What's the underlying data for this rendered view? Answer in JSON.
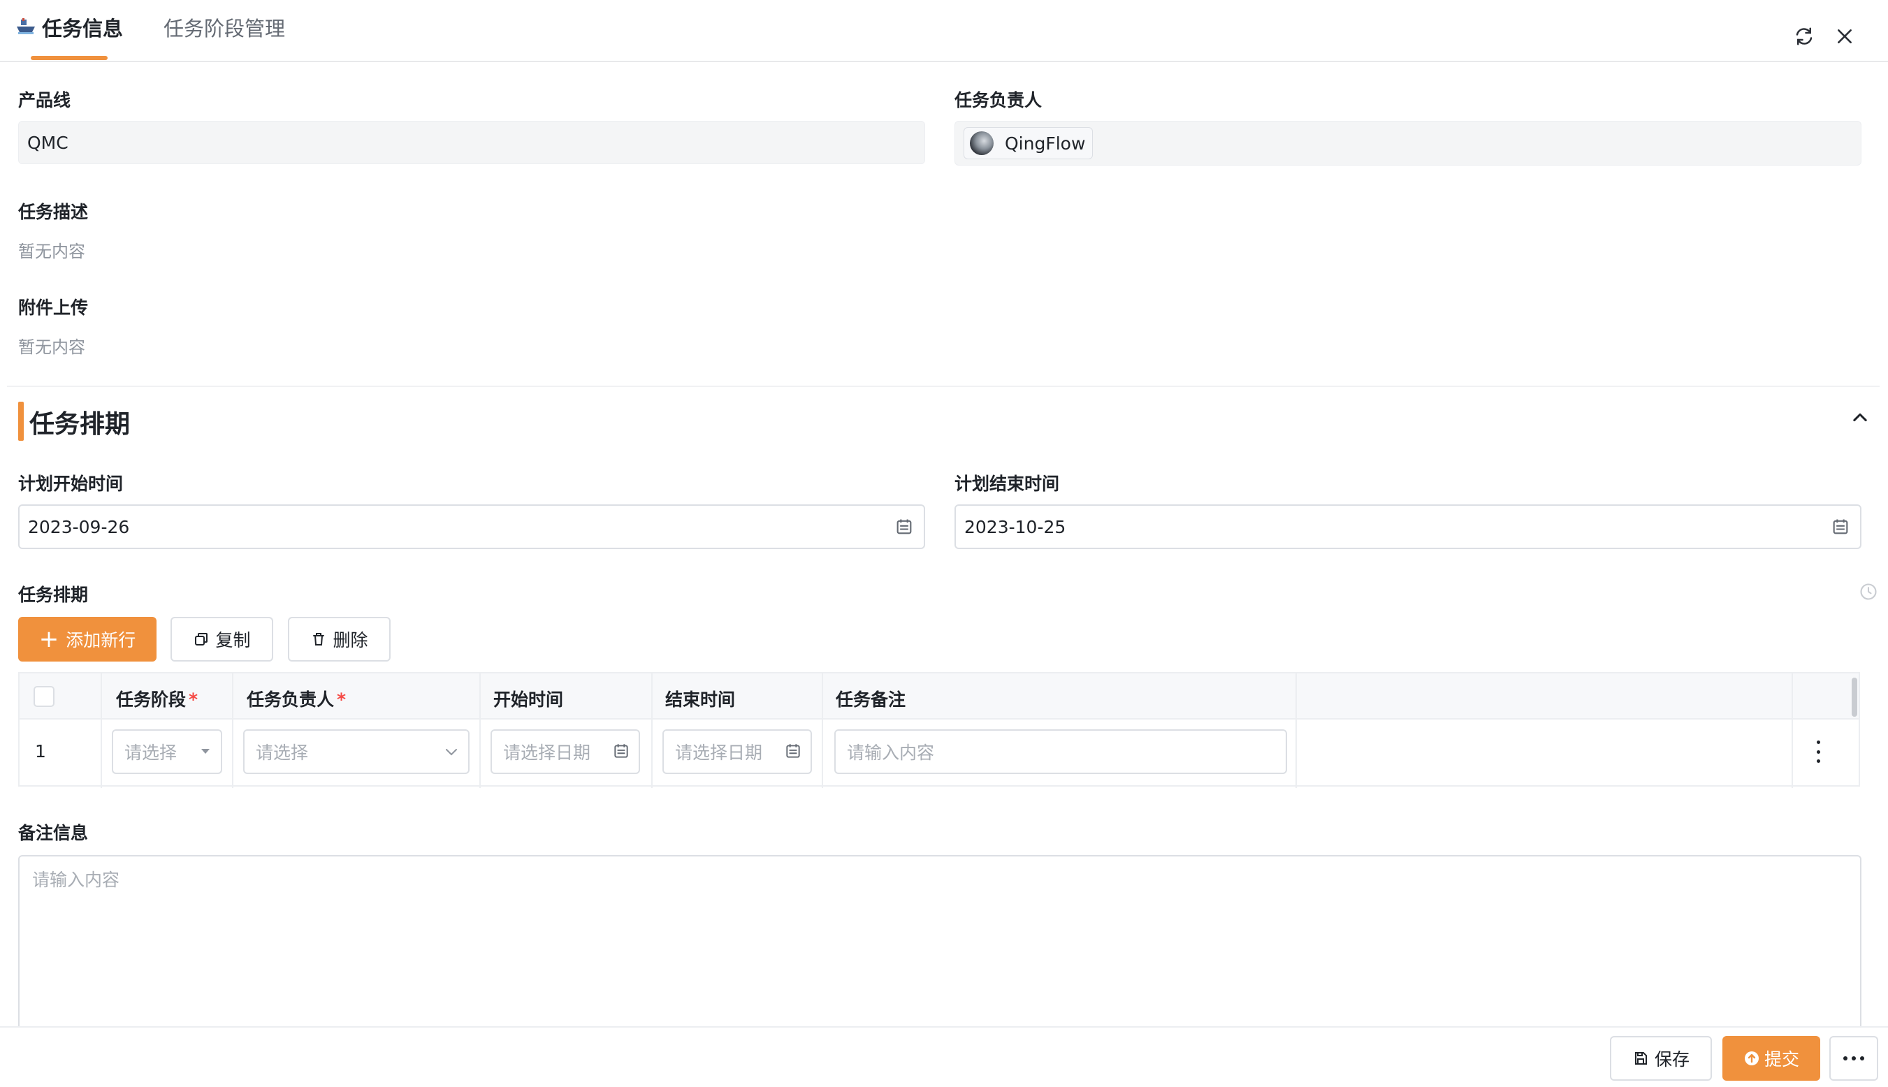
{
  "tabs": [
    {
      "label": "任务信息",
      "active": true,
      "icon": "ship-icon"
    },
    {
      "label": "任务阶段管理",
      "active": false
    }
  ],
  "header_actions": [
    "refresh-icon",
    "close-icon"
  ],
  "fields": {
    "product_line": {
      "label": "产品线",
      "value": "QMC"
    },
    "owner": {
      "label": "任务负责人",
      "value": "QingFlow"
    },
    "description": {
      "label": "任务描述",
      "value": "暂无内容"
    },
    "attachment": {
      "label": "附件上传",
      "value": "暂无内容"
    }
  },
  "section": {
    "title": "任务排期"
  },
  "schedule": {
    "start": {
      "label": "计划开始时间",
      "value": "2023-09-26"
    },
    "end": {
      "label": "计划结束时间",
      "value": "2023-10-25"
    }
  },
  "subtable": {
    "label": "任务排期",
    "buttons": {
      "add": "添加新行",
      "copy": "复制",
      "delete": "删除"
    },
    "columns": [
      "任务阶段",
      "任务负责人",
      "开始时间",
      "结束时间",
      "任务备注"
    ],
    "rows": [
      {
        "index": "1",
        "stage_placeholder": "请选择",
        "owner_placeholder": "请选择",
        "start_placeholder": "请选择日期",
        "end_placeholder": "请选择日期",
        "note_placeholder": "请输入内容"
      }
    ]
  },
  "remark": {
    "label": "备注信息",
    "placeholder": "请输入内容"
  },
  "footer": {
    "save": "保存",
    "submit": "提交"
  },
  "colors": {
    "accent": "#f0913d",
    "required": "#f54a45"
  }
}
